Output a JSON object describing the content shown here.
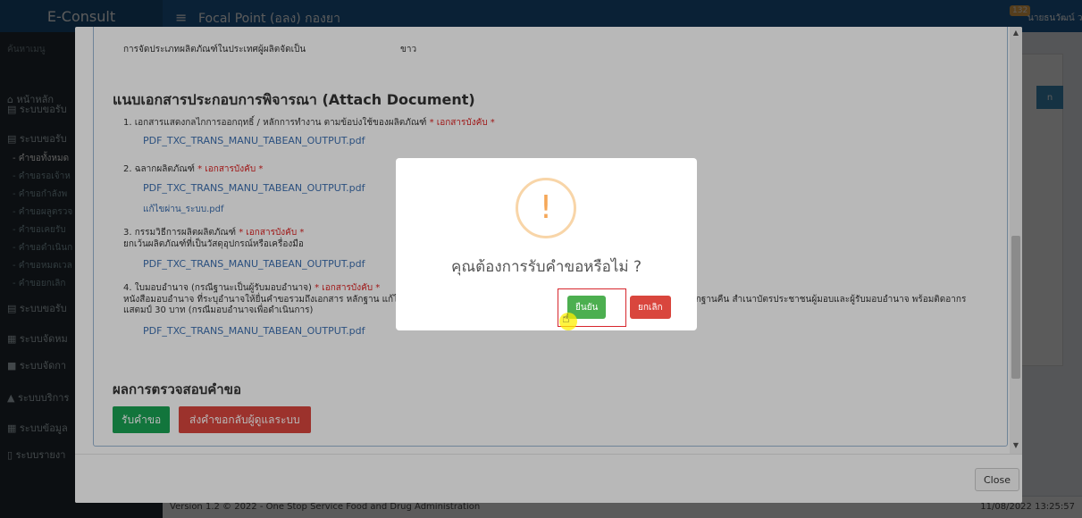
{
  "header": {
    "brand": "E-Consult",
    "title": "Focal Point (อลง) กองยา",
    "badge": "132",
    "user": "นายธนวัฒน์ วงศ์ศักดิ์พงศ์"
  },
  "sidebar": {
    "search": "ค้นหาเมนู",
    "items": [
      {
        "label": "หน้าหลัก",
        "icon": "home-icon"
      },
      {
        "label": "ระบบขอรับ",
        "icon": "book-icon"
      },
      {
        "label": "ระบบขอรับ",
        "icon": "book-icon"
      },
      {
        "label": "ระบบขอรับ",
        "icon": "book-icon"
      },
      {
        "label": "ระบบจัดหม",
        "icon": "calendar-icon"
      },
      {
        "label": "ระบบจัดกา",
        "icon": "video-icon"
      },
      {
        "label": "ระบบบริการ",
        "icon": "graduation-icon"
      },
      {
        "label": "ระบบข้อมูล",
        "icon": "calendar-icon"
      },
      {
        "label": "ระบบรายงา",
        "icon": "file-icon"
      }
    ],
    "subitems": [
      {
        "label": "- คำขอทั้งหมด",
        "active": true
      },
      {
        "label": "- คำขอรอเจ้าห",
        "active": false
      },
      {
        "label": "- คำขอกำลังพ",
        "active": false
      },
      {
        "label": "- คำขอผลูตรวจ",
        "active": false
      },
      {
        "label": "- คำขอเคยรับ",
        "active": false
      },
      {
        "label": "- คำขอดำเนินก",
        "active": false
      },
      {
        "label": "- คำขอหมดเวล",
        "active": false
      },
      {
        "label": "- คำขอยกเลิก",
        "active": false
      }
    ]
  },
  "footer": {
    "left": "Version 1.2 © 2022 - One Stop Service Food and Drug Administration",
    "right": "11/08/2022 13:25:57"
  },
  "modal": {
    "prev_label": "การจัดประเภทผลิตภัณฑ์ในประเทศผู้ผลิตจัดเป็น",
    "prev_value": "ขาว",
    "section_title": "แนบเอกสารประกอบการพิจารณา (Attach Document)",
    "required_text": "* เอกสารบังคับ *",
    "docs": [
      {
        "label": "1. เอกสารแสดงกลไกการออกฤทธิ์ / หลักการทำงาน ตามข้อบ่งใช้ของผลิตภัณฑ์",
        "files": [
          "PDF_TXC_TRANS_MANU_TABEAN_OUTPUT.pdf"
        ]
      },
      {
        "label": "2. ฉลากผลิตภัณฑ์",
        "files": [
          "PDF_TXC_TRANS_MANU_TABEAN_OUTPUT.pdf",
          "แก้ไขผ่าน_ระบบ.pdf"
        ]
      },
      {
        "label": "3. กรรมวิธีการผลิตผลิตภัณฑ์",
        "note": "ยกเว้นผลิตภัณฑ์ที่เป็นวัสดุอุปกรณ์หรือเครื่องมือ",
        "files": [
          "PDF_TXC_TRANS_MANU_TABEAN_OUTPUT.pdf"
        ]
      },
      {
        "label": "4. ใบมอบอำนาจ (กรณีฐานะเป็นผู้รับมอบอำนาจ)",
        "note": "หนังสือมอบอำนาจ ที่ระบุอำนาจให้ยื่นคำขอรวมถึงเอกสาร หลักฐาน แก้ไข",
        "note_right": "หลักฐานคืน สำเนาบัตรประชาชนผู้มอบและผู้รับมอบอำนาจ พร้อมติดอากร",
        "note2": "แสตมป์ 30 บาท (กรณีมอบอำนาจเพื่อดำเนินการ)",
        "files": [
          "PDF_TXC_TRANS_MANU_TABEAN_OUTPUT.pdf"
        ]
      }
    ],
    "result_title": "ผลการตรวจสอบคำขอ",
    "accept_label": "รับคำขอ",
    "return_label": "ส่งคำขอกลับผู้ดูแลระบบ",
    "close_label": "Close"
  },
  "confirm": {
    "icon": "!",
    "question": "คุณต้องการรับคำขอหรือไม่ ?",
    "ok_label": "ยืนยัน",
    "cancel_label": "ยกเลิก"
  }
}
